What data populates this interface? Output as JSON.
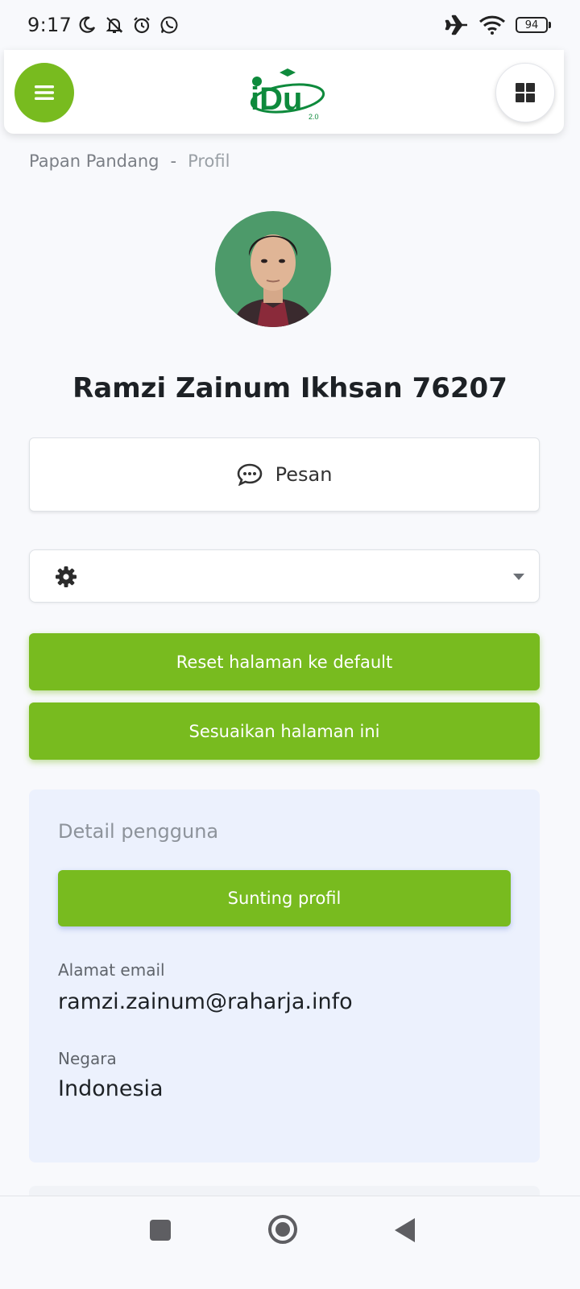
{
  "status_bar": {
    "time": "9:17",
    "battery": "94",
    "icons": [
      "moon-icon",
      "bell-off-icon",
      "alarm-icon",
      "whatsapp-icon",
      "airplane-icon",
      "wifi-icon",
      "battery-icon"
    ]
  },
  "header": {
    "logo_text": "iDu",
    "logo_version": "2.0",
    "menu_icon": "hamburger-icon",
    "apps_icon": "grid-icon"
  },
  "breadcrumb": {
    "home": "Papan Pandang",
    "separator": "-",
    "current": "Profil"
  },
  "profile": {
    "name": "Ramzi Zainum Ikhsan 76207"
  },
  "actions": {
    "message_label": "Pesan",
    "select_value": "",
    "reset_label": "Reset halaman ke default",
    "customize_label": "Sesuaikan halaman ini"
  },
  "details": {
    "title": "Detail pengguna",
    "edit_label": "Sunting profil",
    "email_label": "Alamat email",
    "email_value": "ramzi.zainum@raharja.info",
    "country_label": "Negara",
    "country_value": "Indonesia"
  },
  "colors": {
    "accent": "#78bb1f",
    "logo_green": "#0e8a3c",
    "card_bg": "#ecf1fd"
  }
}
